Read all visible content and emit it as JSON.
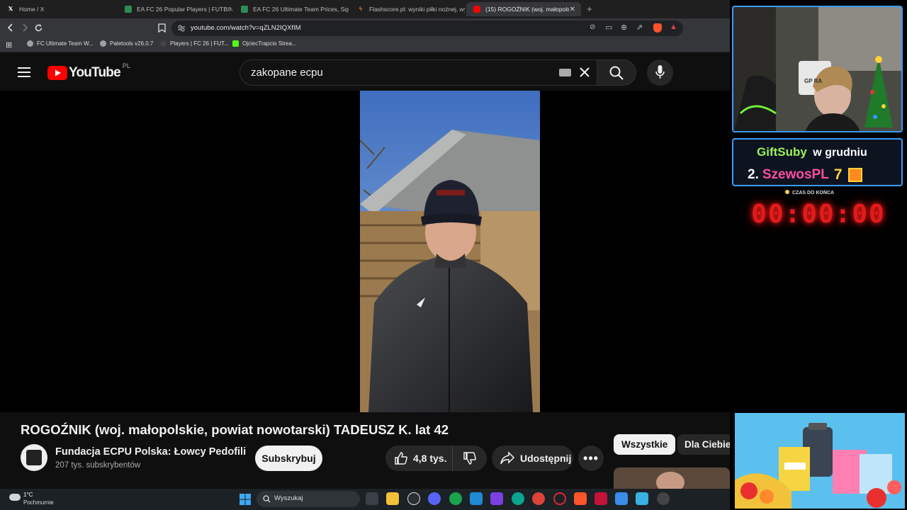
{
  "browser": {
    "tabs": [
      {
        "label": "Home / X",
        "icon": "x-logo-icon"
      },
      {
        "label": "EA FC 26 Popular Players | FUTBIN",
        "icon": "futbin-icon"
      },
      {
        "label": "EA FC 26 Ultimate Team Prices, Squa",
        "icon": "futbin-icon"
      },
      {
        "label": "Flashscore.pl: wyniki piłki nożnej, wy",
        "icon": "flashscore-icon"
      },
      {
        "label": "(15) ROGOŹNIK (woj. małopolsk",
        "icon": "youtube-icon",
        "active": true
      }
    ],
    "new_tab": "+",
    "url": "youtube.com/watch?v=qZLN2IQXfIM",
    "bookmarks": [
      {
        "label": "FC Ultimate Team W...",
        "color": "#9aa0a6"
      },
      {
        "label": "Paletools v26.0.7",
        "color": "#9aa0a6"
      },
      {
        "label": "Players | FC 26 | FUT...",
        "color": "#444444"
      },
      {
        "label": "OjciecTrapcio Strea...",
        "color": "#53fc18"
      }
    ]
  },
  "youtube": {
    "logo_text": "YouTube",
    "region": "PL",
    "search_value": "zakopane ecpu",
    "video_title": "ROGOŹNIK (woj. małopolskie, powiat nowotarski) TADEUSZ K. lat 42",
    "channel_name": "Fundacja ECPU Polska: Łowcy Pedofili",
    "subscribers": "207 tys. subskrybentów",
    "subscribe_label": "Subskrybuj",
    "likes": "4,8 tys.",
    "share_label": "Udostępnij",
    "chips": [
      "Wszystkie",
      "Dla Ciebie"
    ],
    "brand_color": "#ff0000"
  },
  "overlay": {
    "sub_title_a": "GiftSuby",
    "sub_title_b": "w grudniu",
    "rank": "2.",
    "top_gifter": "SzewosPL",
    "gift_count": "7",
    "timer_label": "CZAS DO KOŃCA",
    "timer": "00:00:00",
    "webcam_sign": "GP RA"
  },
  "taskbar": {
    "temperature": "1°C",
    "weather": "Pochmurnie",
    "search_placeholder": "Wyszukaj"
  }
}
